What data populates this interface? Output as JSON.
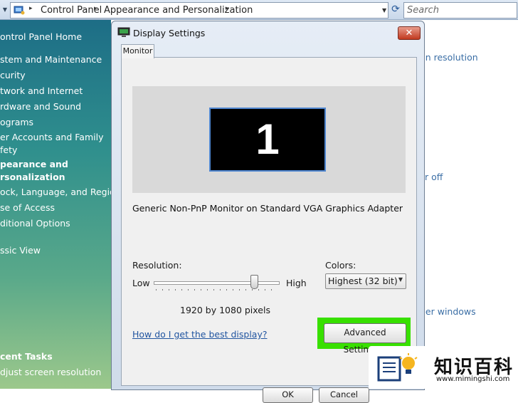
{
  "address_bar": {
    "crumbs": [
      "Control Panel",
      "Appearance and Personalization"
    ],
    "search_placeholder": "Search"
  },
  "left_pane": {
    "items": [
      {
        "label": "ontrol Panel Home",
        "bold": false
      },
      {
        "label": "stem and Maintenance",
        "bold": false
      },
      {
        "label": "curity",
        "bold": false
      },
      {
        "label": "twork and Internet",
        "bold": false
      },
      {
        "label": "rdware and Sound",
        "bold": false
      },
      {
        "label": "ograms",
        "bold": false
      },
      {
        "label": "er Accounts and Family fety",
        "bold": false
      },
      {
        "label": "pearance and rsonalization",
        "bold": true
      },
      {
        "label": "ock, Language, and Region",
        "bold": false
      },
      {
        "label": "se of Access",
        "bold": false
      },
      {
        "label": "ditional Options",
        "bold": false
      },
      {
        "label": "ssic View",
        "bold": false
      }
    ],
    "recent_tasks_heading": "cent Tasks",
    "recent_tasks": [
      "djust screen resolution"
    ]
  },
  "background_links": [
    "en resolution",
    "r off",
    "her windows"
  ],
  "dialog": {
    "title": "Display Settings",
    "close_glyph": "✕",
    "tab": "Monitor",
    "monitor_number": "1",
    "adapter_text": "Generic Non-PnP Monitor on Standard VGA Graphics Adapter",
    "resolution": {
      "label": "Resolution:",
      "low": "Low",
      "high": "High",
      "value_text": "1920 by 1080 pixels",
      "slider_fraction": 0.8
    },
    "colors": {
      "label": "Colors:",
      "selected": "Highest (32 bit)"
    },
    "help_link": "How do I get the best display?",
    "advanced_button": "Advanced Settings...",
    "highlight_color": "#38e000",
    "ok_button": "OK",
    "cancel_button": "Cancel"
  },
  "watermark": {
    "title": "知识百科",
    "url": "www.mimingshi.com"
  }
}
